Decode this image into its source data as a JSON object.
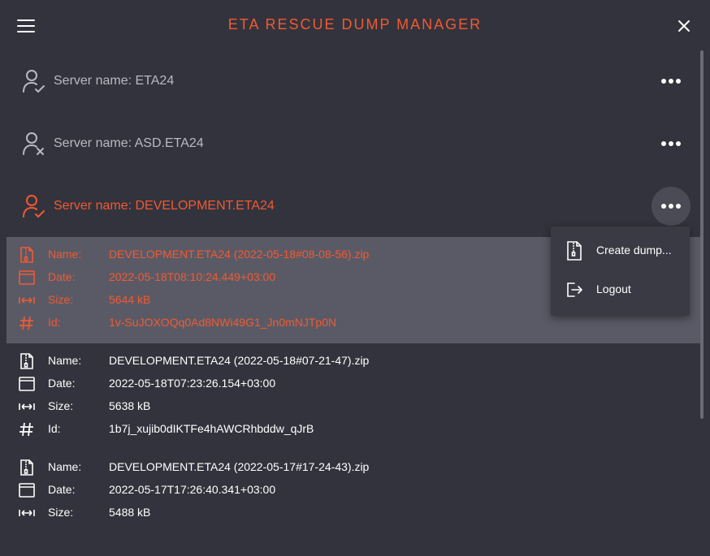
{
  "app": {
    "title": "ETA RESCUE DUMP MANAGER"
  },
  "colors": {
    "accent": "#f05a32",
    "background": "#33333d",
    "selected_row": "#5a5a66",
    "menu_bg": "#3a3a45"
  },
  "servers": [
    {
      "label": "Server name: ETA24",
      "status_icon": "user-check-icon",
      "active": false
    },
    {
      "label": "Server name: ASD.ETA24",
      "status_icon": "user-x-icon",
      "active": false
    },
    {
      "label": "Server name: DEVELOPMENT.ETA24",
      "status_icon": "user-check-icon",
      "active": true
    }
  ],
  "field_labels": {
    "name": "Name:",
    "date": "Date:",
    "size": "Size:",
    "id": "Id:"
  },
  "dumps": [
    {
      "name": "DEVELOPMENT.ETA24 (2022-05-18#08-08-56).zip",
      "date": "2022-05-18T08:10:24.449+03:00",
      "size": "5644 kB",
      "id": "1v-SuJOXOQq0Ad8NWi49G1_Jn0mNJTp0N",
      "selected": true
    },
    {
      "name": "DEVELOPMENT.ETA24 (2022-05-18#07-21-47).zip",
      "date": "2022-05-18T07:23:26.154+03:00",
      "size": "5638 kB",
      "id": "1b7j_xujib0dIKTFe4hAWCRhbddw_qJrB",
      "selected": false
    },
    {
      "name": "DEVELOPMENT.ETA24 (2022-05-17#17-24-43).zip",
      "date": "2022-05-17T17:26:40.341+03:00",
      "size": "5488 kB",
      "selected": false
    }
  ],
  "context_menu": {
    "items": [
      {
        "label": "Create dump...",
        "icon": "zip-file-icon"
      },
      {
        "label": "Logout",
        "icon": "logout-icon"
      }
    ]
  }
}
